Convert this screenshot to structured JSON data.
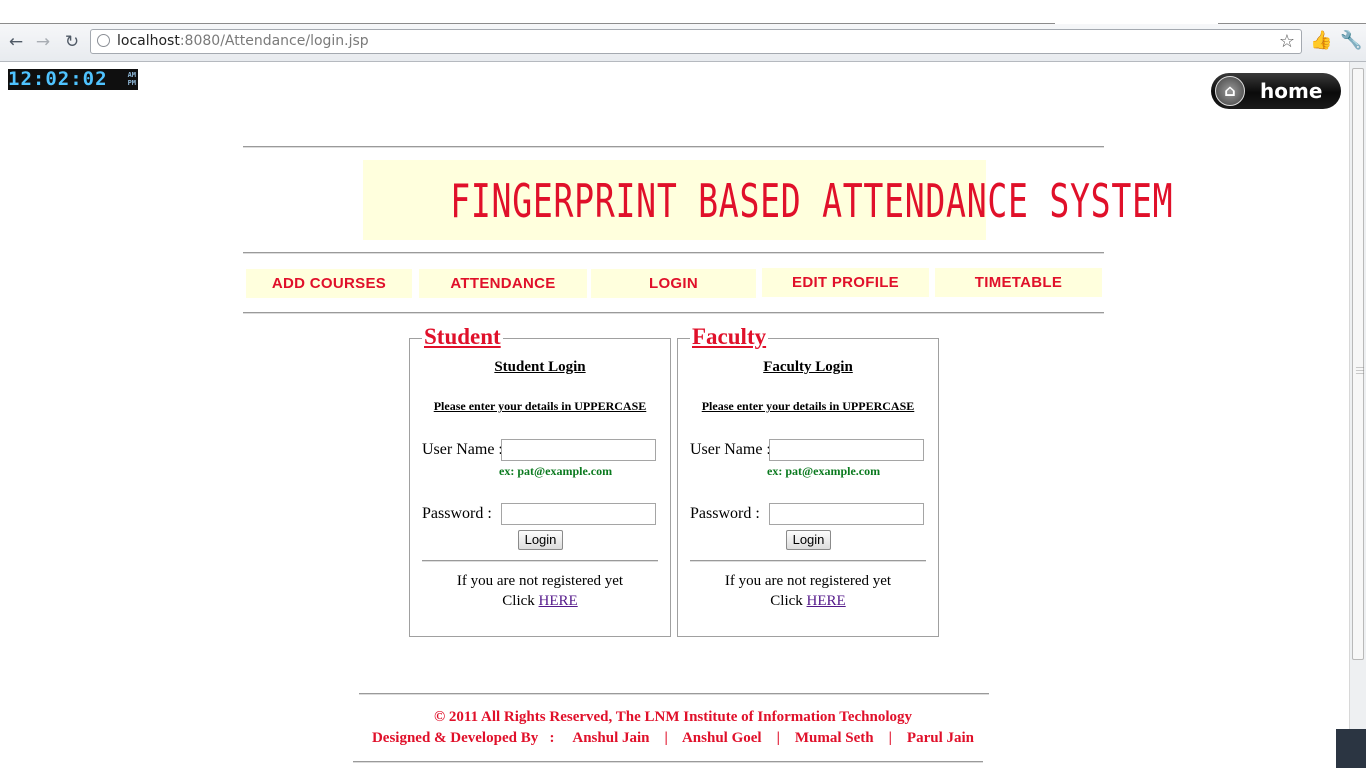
{
  "browser": {
    "url_host": "localhost",
    "url_rest": ":8080/Attendance/login.jsp"
  },
  "clock": {
    "time": "12:02:02",
    "am": "AM",
    "pm": "PM"
  },
  "home": {
    "label": "home"
  },
  "banner": {
    "title": "FINGERPRINT BASED ATTENDANCE SYSTEM"
  },
  "menu": {
    "items": [
      {
        "label": "ADD COURSES"
      },
      {
        "label": "ATTENDANCE"
      },
      {
        "label": "LOGIN"
      },
      {
        "label": "EDIT PROFILE"
      },
      {
        "label": "TIMETABLE"
      }
    ]
  },
  "student": {
    "legend": "Student",
    "title": "Student Login",
    "note": "Please enter your details in UPPERCASE",
    "username_label": "User Name :",
    "username_value": "",
    "example": "ex: pat@example.com",
    "password_label": "Password :",
    "password_value": "",
    "login_button": "Login",
    "register_line": "If you are not registered yet",
    "click_text": "Click",
    "here_link": "HERE"
  },
  "faculty": {
    "legend": "Faculty",
    "title": "Faculty Login",
    "note": "Please enter your details in UPPERCASE",
    "username_label": "User Name :",
    "username_value": "",
    "example": "ex: pat@example.com",
    "password_label": "Password :",
    "password_value": "",
    "login_button": "Login",
    "register_line": "If you are not registered yet",
    "click_text": "Click",
    "here_link": "HERE"
  },
  "footer": {
    "copyright": "© 2011 All Rights Reserved, The LNM Institute of Information Technology",
    "credits": "Designed & Developed By   :     Anshul Jain    |    Anshul Goel    |    Mumal Seth    |    Parul Jain"
  },
  "colors": {
    "accent_red": "#e0102a",
    "banner_bg": "#ffffdd",
    "example_green": "#0b7a1f"
  }
}
